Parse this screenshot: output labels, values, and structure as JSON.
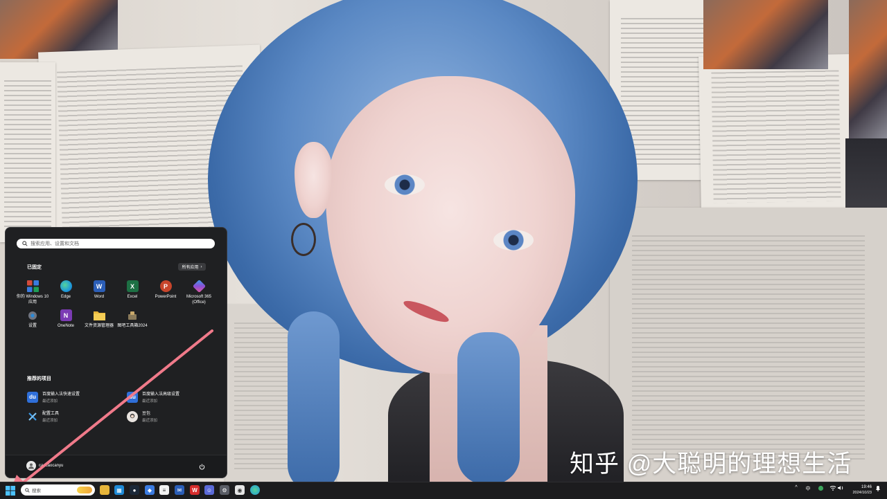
{
  "desktop": {
    "watermark": "知乎 @大聪明的理想生活"
  },
  "start_menu": {
    "search_placeholder": "搜索应用、设置和文档",
    "pinned_title": "已固定",
    "all_apps_label": "所有应用",
    "pinned_apps": [
      {
        "label": "你的 Windows 10 应用",
        "icon": "windows-apps-icon",
        "color": "#5b7bd5"
      },
      {
        "label": "Edge",
        "icon": "edge-icon",
        "color": "#1f9ad8"
      },
      {
        "label": "Word",
        "icon": "word-icon",
        "color": "#2b5eb7"
      },
      {
        "label": "Excel",
        "icon": "excel-icon",
        "color": "#1d7044"
      },
      {
        "label": "PowerPoint",
        "icon": "powerpoint-icon",
        "color": "#c8452b"
      },
      {
        "label": "Microsoft 365 (Office)",
        "icon": "m365-icon",
        "color": "#6b5fd6"
      },
      {
        "label": "设置",
        "icon": "settings-gear-icon",
        "color": "#4a4d54"
      },
      {
        "label": "OneNote",
        "icon": "onenote-icon",
        "color": "#7b3bb4"
      },
      {
        "label": "文件资源管理器",
        "icon": "file-explorer-icon",
        "color": "#e7b53a"
      },
      {
        "label": "图吧工具箱2024",
        "icon": "toolbox-icon",
        "color": "#8a7a5a"
      }
    ],
    "recommended_title": "推荐的项目",
    "recommended": [
      {
        "name": "百度输入法快速设置",
        "sub": "最近添加",
        "icon": "baidu-du-icon",
        "color": "#2f6fd9"
      },
      {
        "name": "百度输入法高级设置",
        "sub": "最近添加",
        "icon": "baidu-du-icon",
        "color": "#2f6fd9"
      },
      {
        "name": "配置工具",
        "sub": "最近添加",
        "icon": "tools-icon",
        "color": "#2a7bd8"
      },
      {
        "name": "豆包",
        "sub": "最近添加",
        "icon": "doubao-icon",
        "color": "#e9e4e0"
      }
    ],
    "user_name": "caocaocanyu"
  },
  "taskbar": {
    "search_placeholder": "搜索",
    "ime_label": "中",
    "time": "19:46",
    "date": "2024/10/23"
  },
  "colors": {
    "start_bg": "#1f2022",
    "taskbar_bg": "#1c1c1e",
    "arrow": "#f07a8a"
  }
}
